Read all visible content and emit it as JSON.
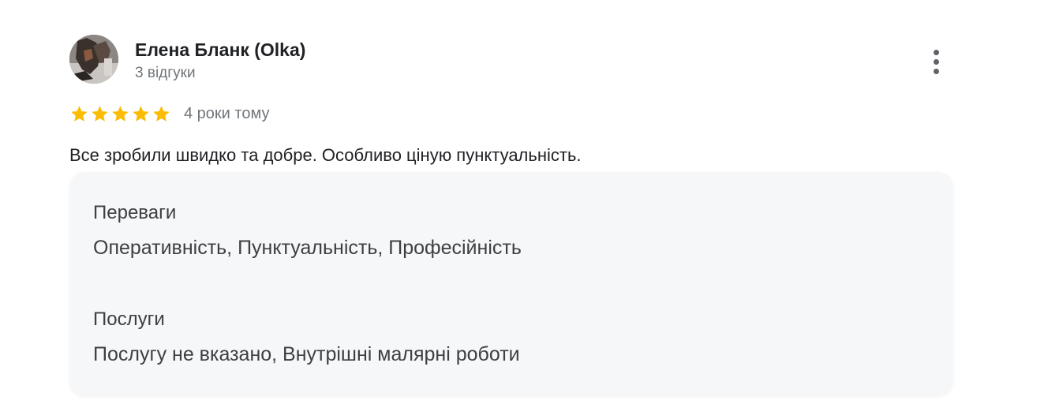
{
  "review": {
    "author_name": "Елена Бланк (Olka)",
    "review_count": "3 відгуки",
    "rating": 5,
    "date": "4 роки тому",
    "text": "Все зробили швидко та добре. Особливо ціную пунктуальність.",
    "star_color": "#fbbc04",
    "details": [
      {
        "heading": "Переваги",
        "value": "Оперативність, Пунктуальність, Професійність"
      },
      {
        "heading": "Послуги",
        "value": "Послугу не вказано, Внутрішні малярні роботи"
      }
    ]
  },
  "icons": {
    "more": "more-vert-icon",
    "star": "star-icon"
  }
}
